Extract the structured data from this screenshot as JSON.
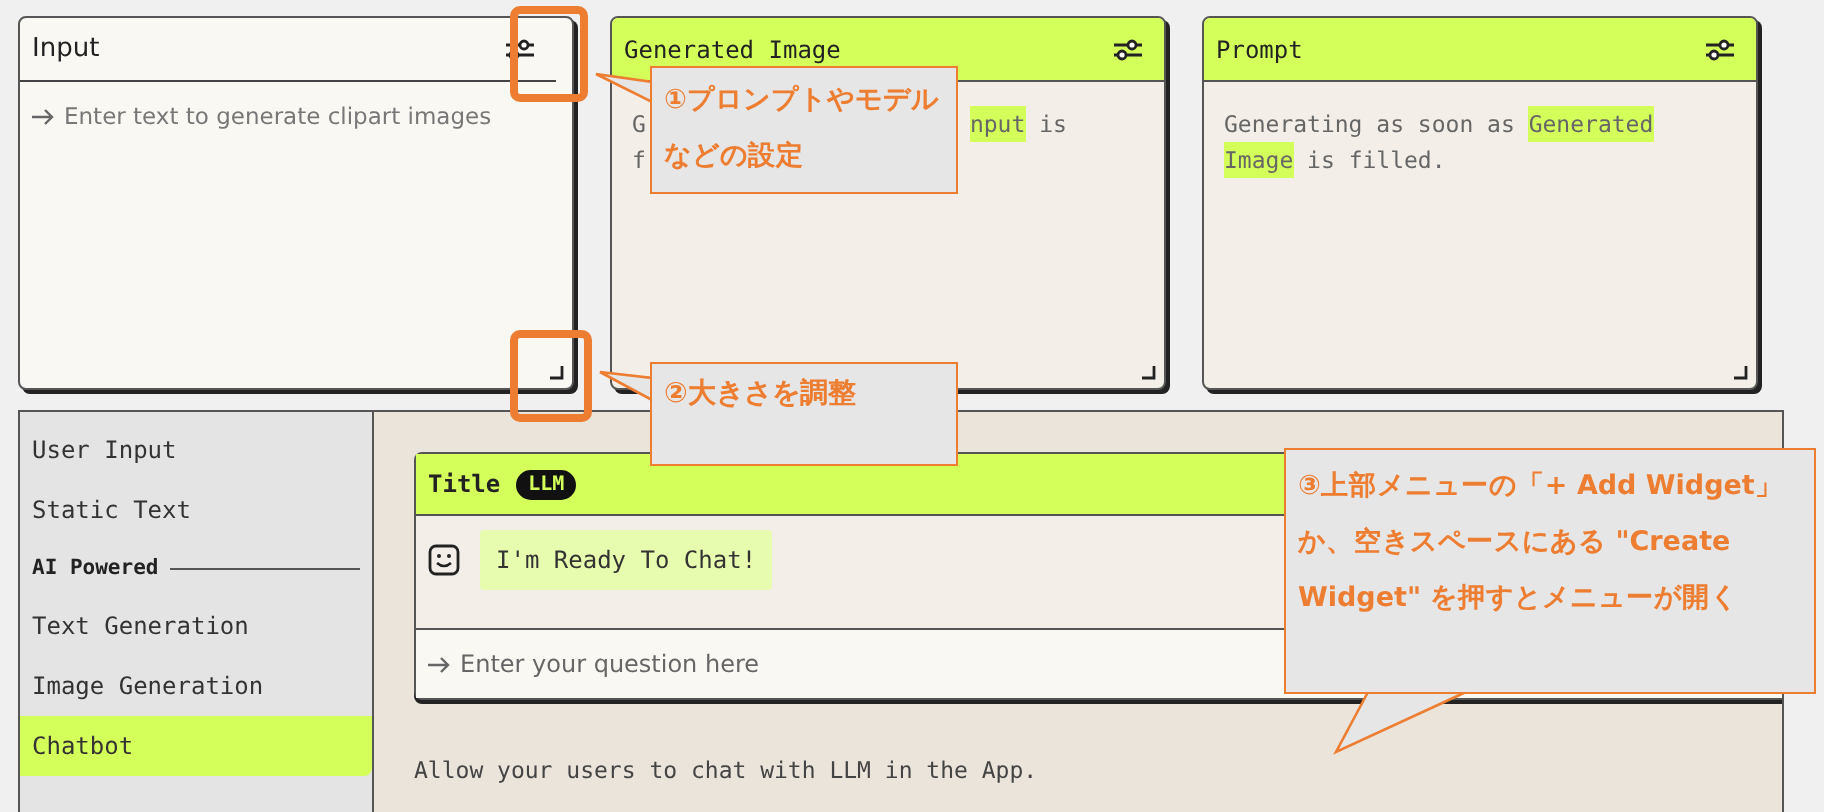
{
  "cards": [
    {
      "kind": "input",
      "title": "Input",
      "placeholder": "Enter text to generate clipart images"
    },
    {
      "kind": "output",
      "title": "Generated Image",
      "lines": [
        [
          {
            "text": "G",
            "highlight": false
          },
          {
            "text": "nput",
            "highlight": true,
            "covered_before": true
          },
          {
            "text": " is",
            "highlight": false
          }
        ],
        [
          {
            "text": "f",
            "highlight": false
          }
        ]
      ]
    },
    {
      "kind": "output",
      "title": "Prompt",
      "lines": [
        [
          {
            "text": "Generating as soon as ",
            "highlight": false
          },
          {
            "text": "Generated",
            "highlight": true
          }
        ],
        [
          {
            "text": "Image",
            "highlight": true
          },
          {
            "text": " is filled.",
            "highlight": false
          }
        ]
      ]
    }
  ],
  "sidebar": {
    "items": [
      {
        "kind": "item",
        "label": "User Input",
        "selected": false
      },
      {
        "kind": "item",
        "label": "Static Text",
        "selected": false
      },
      {
        "kind": "heading",
        "label": "AI Powered"
      },
      {
        "kind": "item",
        "label": "Text Generation",
        "selected": false
      },
      {
        "kind": "item",
        "label": "Image Generation",
        "selected": false
      },
      {
        "kind": "item",
        "label": "Chatbot",
        "selected": true
      }
    ]
  },
  "preview": {
    "title": "Title",
    "badge": "LLM",
    "message": "I'm Ready To Chat!",
    "input_placeholder": "Enter your question here",
    "description": "Allow your users to chat with LLM in the App."
  },
  "callouts": [
    {
      "number": "①",
      "text": "プロンプトやモデルなどの設定"
    },
    {
      "number": "②",
      "text": "大きさを調整"
    },
    {
      "number": "③",
      "text": "上部メニューの「+ Add Widget」か、空きスペースにある \"Create Widget\" を押すとメニューが開く"
    }
  ]
}
